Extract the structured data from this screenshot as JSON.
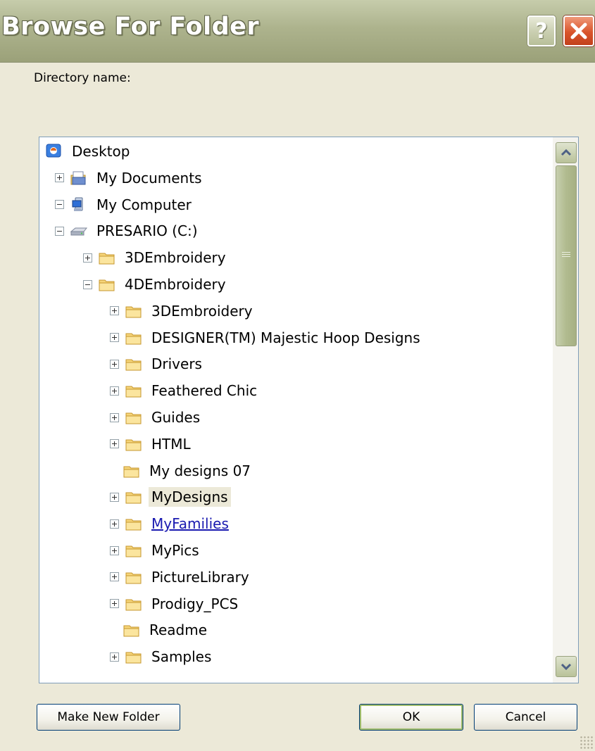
{
  "window": {
    "title": "Browse For Folder",
    "help_label": "?"
  },
  "directory_label": "Directory name:",
  "tree": {
    "items": [
      {
        "label": "Desktop",
        "icon": "desktop-icon",
        "expander": "none",
        "level": 0
      },
      {
        "label": "My Documents",
        "icon": "documents-folder-icon",
        "expander": "plus",
        "level": 1
      },
      {
        "label": "My Computer",
        "icon": "computer-icon",
        "expander": "minus",
        "level": 1
      },
      {
        "label": "PRESARIO (C:)",
        "icon": "drive-icon",
        "expander": "minus",
        "level": 2
      },
      {
        "label": "3DEmbroidery",
        "icon": "folder-icon",
        "expander": "plus",
        "level": 3
      },
      {
        "label": "4DEmbroidery",
        "icon": "folder-icon",
        "expander": "minus",
        "level": 3
      },
      {
        "label": "3DEmbroidery",
        "icon": "folder-icon",
        "expander": "plus",
        "level": 4
      },
      {
        "label": "DESIGNER(TM) Majestic Hoop Designs",
        "icon": "folder-icon",
        "expander": "plus",
        "level": 4
      },
      {
        "label": "Drivers",
        "icon": "folder-icon",
        "expander": "plus",
        "level": 4
      },
      {
        "label": "Feathered Chic",
        "icon": "folder-icon",
        "expander": "plus",
        "level": 4
      },
      {
        "label": "Guides",
        "icon": "folder-icon",
        "expander": "plus",
        "level": 4
      },
      {
        "label": "HTML",
        "icon": "folder-icon",
        "expander": "plus",
        "level": 4
      },
      {
        "label": "My designs 07",
        "icon": "folder-icon",
        "expander": "none",
        "level": 4
      },
      {
        "label": "MyDesigns",
        "icon": "folder-icon",
        "expander": "plus",
        "level": 4,
        "state": "selected"
      },
      {
        "label": "MyFamilies",
        "icon": "folder-icon",
        "expander": "plus",
        "level": 4,
        "state": "hover"
      },
      {
        "label": "MyPics",
        "icon": "folder-icon",
        "expander": "plus",
        "level": 4
      },
      {
        "label": "PictureLibrary",
        "icon": "folder-icon",
        "expander": "plus",
        "level": 4
      },
      {
        "label": "Prodigy_PCS",
        "icon": "folder-icon",
        "expander": "plus",
        "level": 4
      },
      {
        "label": "Readme",
        "icon": "folder-icon",
        "expander": "none",
        "level": 4
      },
      {
        "label": "Samples",
        "icon": "folder-icon",
        "expander": "plus",
        "level": 4
      }
    ]
  },
  "buttons": {
    "make_new_folder": "Make New Folder",
    "ok": "OK",
    "cancel": "Cancel"
  },
  "colors": {
    "title_bar": "#adb38d",
    "dialog_bg": "#ece9d8",
    "close_button": "#d9542b",
    "link": "#1a1ab0"
  }
}
